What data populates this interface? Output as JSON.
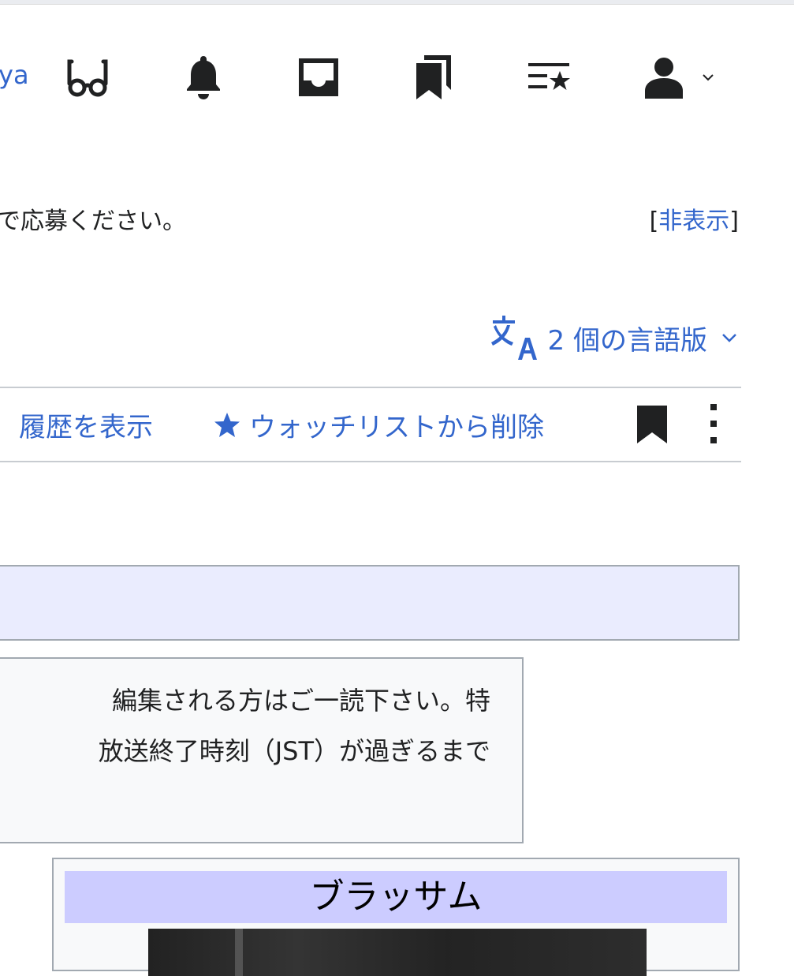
{
  "header": {
    "username_fragment": "ya",
    "icons": [
      "reading-glasses-icon",
      "bell-icon",
      "inbox-icon",
      "bookmarks-icon",
      "watchlist-icon",
      "user-icon"
    ]
  },
  "notice": {
    "text": "で応募ください。",
    "hide_open": "[",
    "hide_label": "非表示",
    "hide_close": "]"
  },
  "languages": {
    "label": "2 個の言語版"
  },
  "tabs": {
    "history": "履歴を表示",
    "watch": "ウォッチリストから削除"
  },
  "message": {
    "line1": "編集される方はご一読下さい。特",
    "line2": "放送終了時刻（JST）が過ぎるまで"
  },
  "infobox": {
    "title": "ブラッサム"
  },
  "colors": {
    "link": "#3366cc",
    "infobox_title_bg": "#ccccff",
    "banner_bg": "#eaecfe"
  }
}
